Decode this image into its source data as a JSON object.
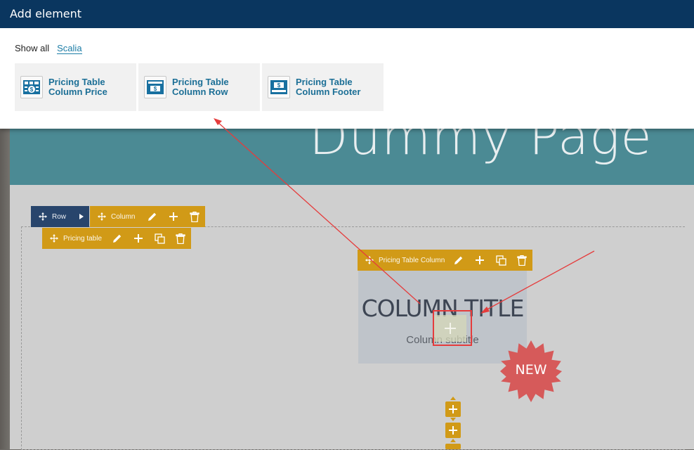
{
  "modal": {
    "title": "Add element",
    "filters": [
      "Show all",
      "Scalia"
    ],
    "cards": [
      {
        "line1": "Pricing Table",
        "line2": "Column Price",
        "icon": "pricing-price-icon"
      },
      {
        "line1": "Pricing Table",
        "line2": "Column Row",
        "icon": "pricing-row-icon"
      },
      {
        "line1": "Pricing Table",
        "line2": "Column Footer",
        "icon": "pricing-footer-icon"
      }
    ]
  },
  "page": {
    "hero_title": "Dummy Page",
    "row_label": "Row",
    "column_label": "Column",
    "pricing_table_label": "Pricing table",
    "pricing_column_label": "Pricing Table Column",
    "column_title": "COLUMN TITLE",
    "column_subtitle": "Column subtitle",
    "badge": "NEW"
  },
  "colors": {
    "modal_header": "#0a365f",
    "accent": "#1b7ca6",
    "control_orange": "#d19a17",
    "control_navy": "#28456c",
    "hero": "#4b8a94",
    "badge": "#d65a5a",
    "annotation": "#e53c3c"
  }
}
